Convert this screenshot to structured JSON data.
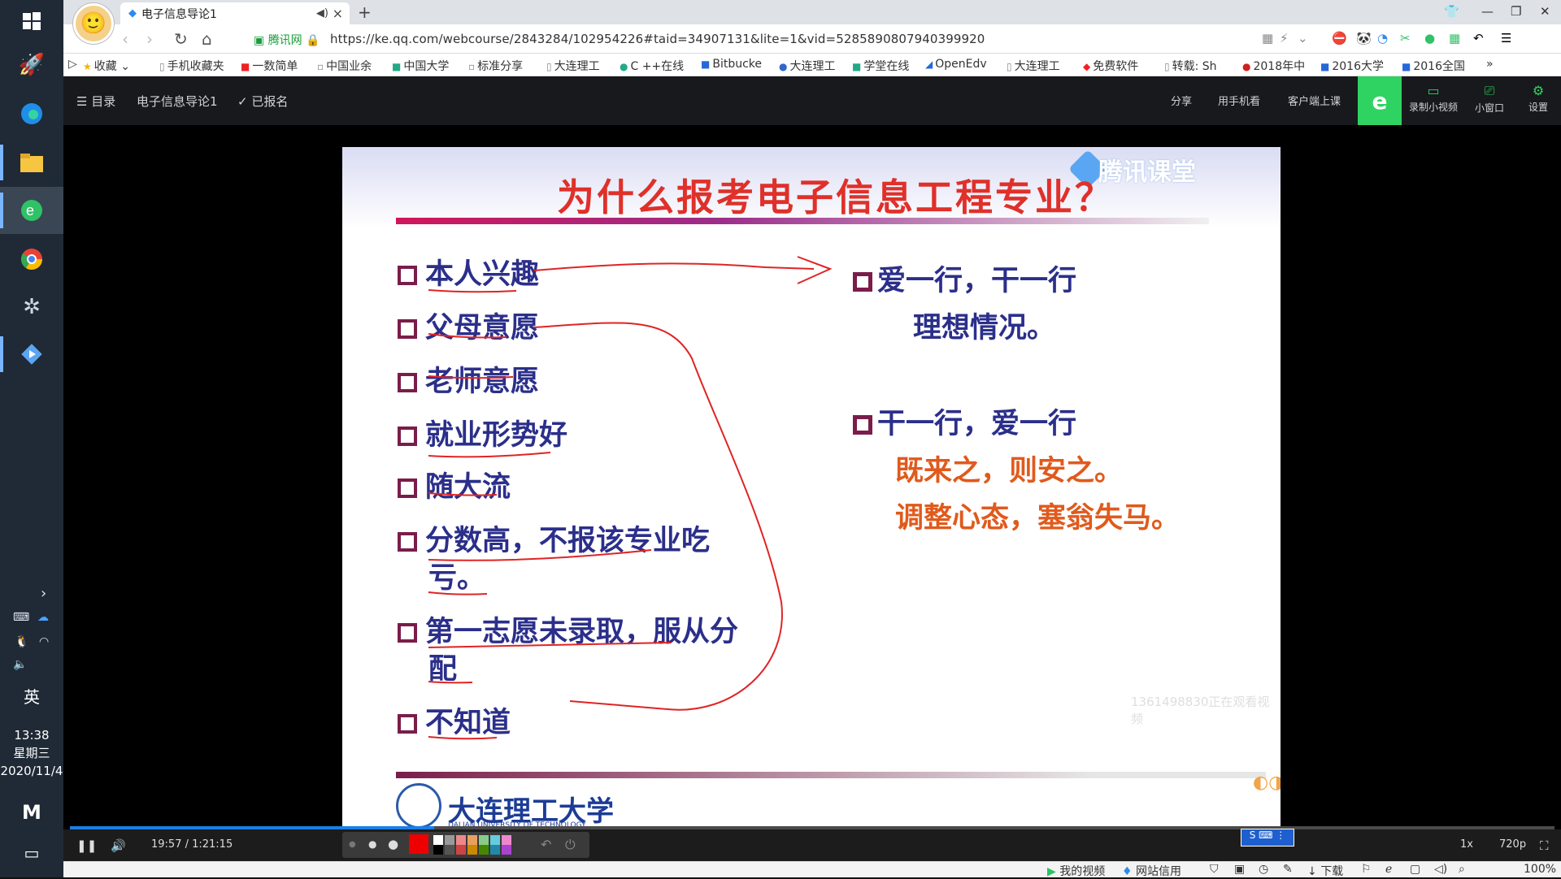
{
  "taskbar": {
    "ime": "英",
    "time": "13:38",
    "weekday": "星期三",
    "date": "2020/11/4"
  },
  "browser": {
    "tab_title": "电子信息导论1",
    "url": "https://ke.qq.com/webcourse/2843284/102954226#taid=34907131&lite=1&vid=5285890807940399920",
    "secure_label": "腾讯网",
    "bookmarks": [
      "收藏",
      "手机收藏夹",
      "一数简单",
      "中国业余",
      "中国大学",
      "标准分享",
      "大连理工",
      "C ++在线",
      "Bitbucke",
      "大连理工",
      "学堂在线",
      "OpenEdv",
      "大连理工",
      "免费软件",
      "转载: Sh",
      "2018年中",
      "2016大学",
      "2016全国"
    ]
  },
  "course_header": {
    "menu_label": "目录",
    "course_name": "电子信息导论1",
    "enrolled_label": "已报名",
    "share_label": "分享",
    "phone_label": "用手机看",
    "client_label": "客户端上课",
    "record_label": "录制小视频",
    "mini_label": "小窗口",
    "settings_label": "设置"
  },
  "slide": {
    "watermark": "腾讯课堂",
    "title": "为什么报考电子信息工程专业？",
    "left_items": [
      "本人兴趣",
      "父母意愿",
      "老师意愿",
      "就业形势好",
      "随大流",
      "分数高，不报该专业吃",
      "亏。",
      "第一志愿未录取，服从分",
      "配",
      "不知道"
    ],
    "right": {
      "item1": "爱一行，干一行",
      "item1_sub": "理想情况。",
      "item2": "干一行，爱一行",
      "item2_sub1": "既来之，则安之。",
      "item2_sub2": "调整心态，塞翁失马。"
    },
    "university": "大连理工大学",
    "university_en": "DALIAN UNIVERSITY OF TECHNOLOGY",
    "viewer_note": "1361498830正在观看视频",
    "colors": {
      "title": "#e0302a",
      "list": "#2b2f8a",
      "orange": "#e05a1c",
      "annotation": "#e02424"
    }
  },
  "player": {
    "time": "19:57 / 1:21:15",
    "progress": 0.2456,
    "speed": "1x",
    "quality": "720p"
  },
  "statusbar": {
    "my_video": "我的视频",
    "site_trust": "网站信用",
    "download": "下载",
    "zoom": "100%"
  }
}
